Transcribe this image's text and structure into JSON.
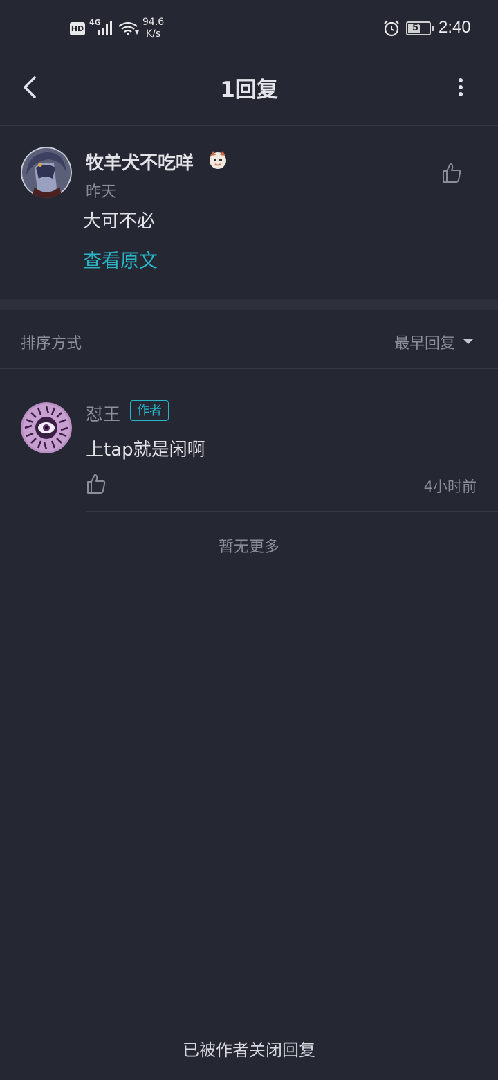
{
  "status_bar": {
    "hd": "HD",
    "network": "4G",
    "speed_value": "94.6",
    "speed_unit": "K/s",
    "battery": "57",
    "battery_level": 0.57,
    "time": "2:40"
  },
  "header": {
    "title": "1回复",
    "back_icon": "chevron-left-icon",
    "more_icon": "more-vertical-icon"
  },
  "main_comment": {
    "username": "牧羊犬不吃咩",
    "time": "昨天",
    "content": "大可不必",
    "view_original": "查看原文"
  },
  "sort": {
    "label": "排序方式",
    "selected": "最早回复"
  },
  "replies": [
    {
      "username": "怼王",
      "badge": "作者",
      "content": "上tap就是闲啊",
      "time": "4小时前"
    }
  ],
  "no_more": "暂无更多",
  "bottom": {
    "closed_text": "已被作者关闭回复"
  },
  "colors": {
    "background": "#252733",
    "accent": "#29b6c9",
    "muted": "#8b8e99"
  }
}
